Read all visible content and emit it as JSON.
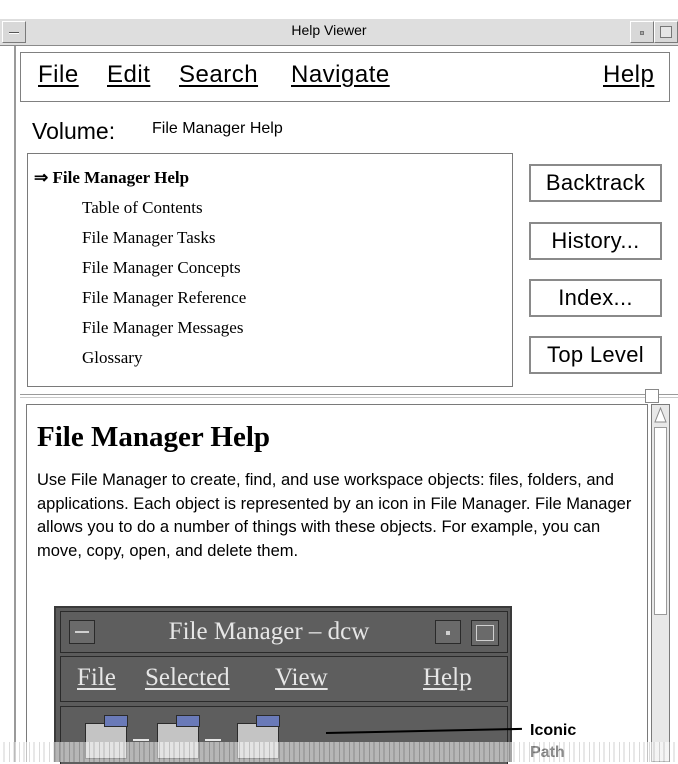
{
  "window": {
    "title": "Help Viewer"
  },
  "menubar": {
    "file": "File",
    "edit": "Edit",
    "search": "Search",
    "navigate": "Navigate",
    "help": "Help"
  },
  "volume": {
    "label": "Volume:",
    "value": "File Manager Help"
  },
  "toc": {
    "current_marker": "⇒",
    "current": "File Manager Help",
    "items": [
      "Table of Contents",
      "File Manager Tasks",
      "File Manager Concepts",
      "File Manager Reference",
      "File Manager Messages",
      "Glossary"
    ]
  },
  "buttons": {
    "backtrack": "Backtrack",
    "history": "History...",
    "index": "Index...",
    "top_level": "Top Level"
  },
  "content": {
    "heading": "File Manager Help",
    "paragraph": "Use File Manager to create, find, and use workspace objects: files, folders, and applications. Each object is represented by an icon in File Manager. File Manager allows you to do a number of things with these objects. For example, you can move, copy, open, and delete them.",
    "figure": {
      "title": "File Manager – dcw",
      "menu": {
        "file": "File",
        "selected": "Selected",
        "view": "View",
        "help": "Help"
      },
      "callout": "Iconic Path"
    }
  },
  "colors": {
    "folder_tab": "#6a7ab8",
    "figure_bg": "#5e5e5e",
    "frame": "#dedede"
  }
}
